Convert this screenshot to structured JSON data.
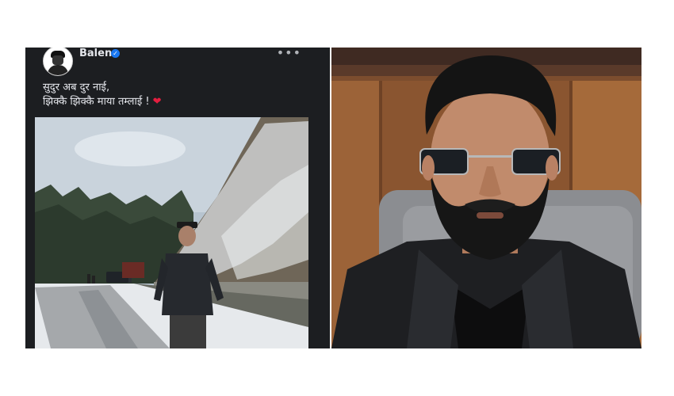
{
  "post": {
    "author": "Balen",
    "verified_icon": "verified-badge-icon",
    "more_icon": "more-options-icon",
    "more_label": "•••",
    "caption_lines": [
      "सुदुर अब दुर नाई,",
      "झिक्कै झिक्कै माया तम्लाई !"
    ],
    "heart": "❤",
    "photo_icon": "snowy-road-photo"
  },
  "portrait": {
    "photo_icon": "man-in-sunglasses-portrait"
  },
  "colors": {
    "post_bg": "#1c1e21",
    "verified": "#1877f2",
    "heart": "#e41e3f"
  }
}
